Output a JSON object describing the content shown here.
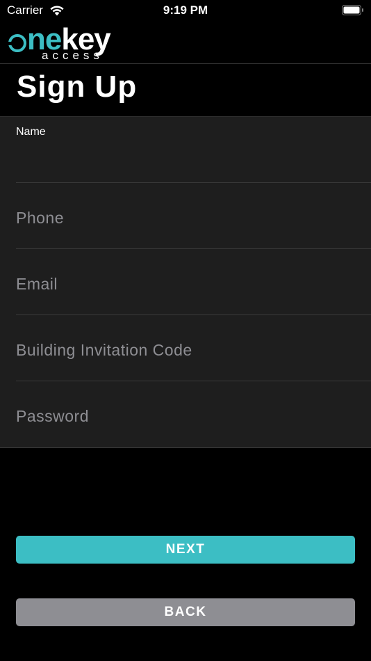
{
  "status_bar": {
    "carrier": "Carrier",
    "time": "9:19 PM",
    "icons": [
      "wifi-icon",
      "battery-icon"
    ]
  },
  "logo": {
    "word_accent": "ne",
    "word_main": "key",
    "subtitle": "access",
    "accent_color": "#3cbec4"
  },
  "page": {
    "title": "Sign Up"
  },
  "form": {
    "name": {
      "label": "Name",
      "value": "",
      "placeholder": ""
    },
    "phone": {
      "placeholder": "Phone",
      "value": ""
    },
    "email": {
      "placeholder": "Email",
      "value": ""
    },
    "invitation_code": {
      "placeholder": "Building Invitation Code",
      "value": ""
    },
    "password": {
      "placeholder": "Password",
      "value": ""
    }
  },
  "buttons": {
    "next_label": "NEXT",
    "back_label": "BACK",
    "next_color": "#3cbec4",
    "back_color": "#8e8e93"
  }
}
